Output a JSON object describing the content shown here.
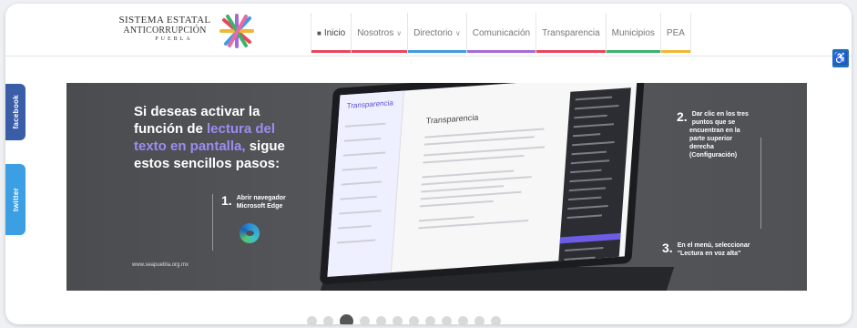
{
  "logo": {
    "line1": "Sistema Estatal",
    "line2": "Anticorrupción",
    "line3": "PUEBLA"
  },
  "nav": {
    "items": [
      {
        "label": "Inicio",
        "bar": "#e8465a",
        "active": true
      },
      {
        "label": "Nosotros",
        "bar": "#e8465a",
        "caret": true
      },
      {
        "label": "Directorio",
        "bar": "#3f9be0",
        "caret": true
      },
      {
        "label": "Comunicación",
        "bar": "#a66ad4"
      },
      {
        "label": "Transparencia",
        "bar": "#e8465a"
      },
      {
        "label": "Municipios",
        "bar": "#3cb26a"
      },
      {
        "label": "PEA",
        "bar": "#f2b632"
      }
    ]
  },
  "social": {
    "facebook": "facebook",
    "twitter": "twitter"
  },
  "banner": {
    "headline_pre": "Si deseas activar la función de ",
    "headline_hl": "lectura del texto en pantalla,",
    "headline_post": " sigue estos sencillos pasos:",
    "step1_num": "1.",
    "step1_text": "Abrir navegador Microsoft Edge",
    "step2_num": "2.",
    "step2_text": "Dar clic en los tres puntos que se encuentran en la parte superior derecha (Configuración)",
    "step3_num": "3.",
    "step3_text": "En el menú, seleccionar \"Lectura en voz alta\"",
    "website": "www.seapuebla.org.mx",
    "screen_title": "Transparencia",
    "screen_sidebar": "Transparencia"
  },
  "carousel": {
    "count": 12,
    "active_index": 2
  },
  "colors": {
    "accent": "#9d8cf0",
    "a11y": "#1f6fb6"
  },
  "icons": [
    "home-icon",
    "accessibility-icon",
    "edge-browser-icon"
  ]
}
